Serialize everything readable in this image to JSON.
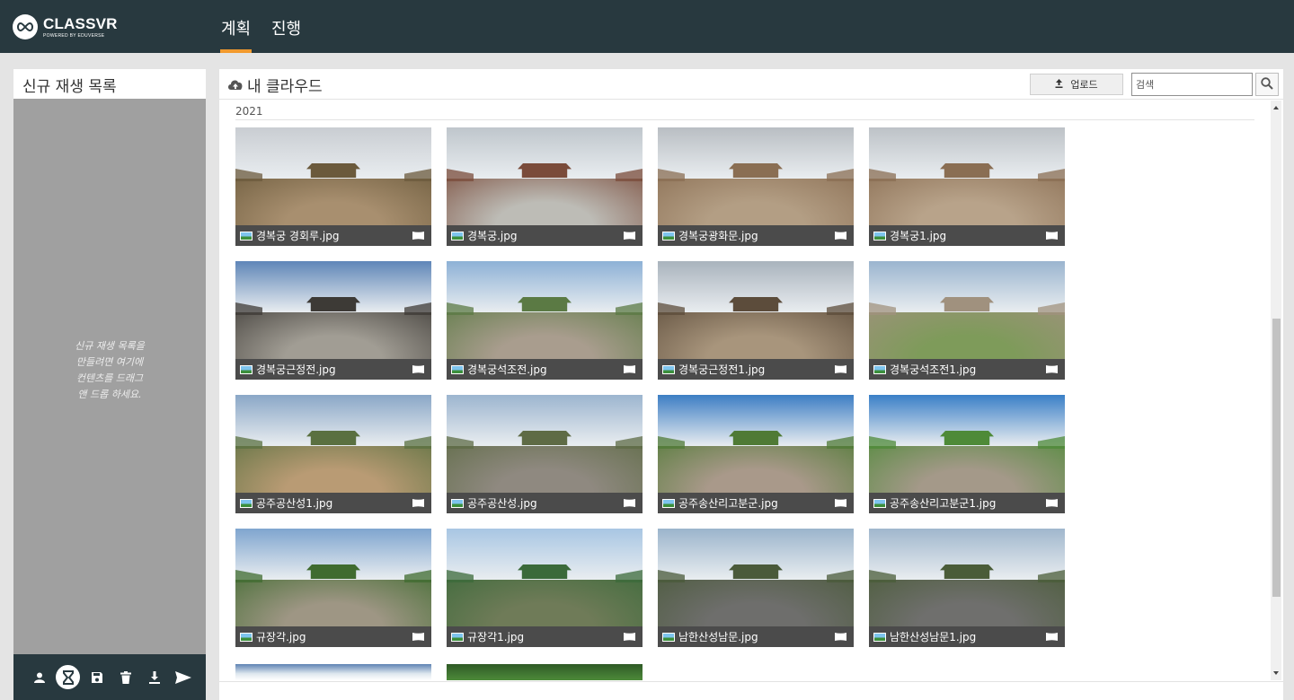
{
  "brand": {
    "name": "CLASSVR",
    "tagline": "POWERED BY EDUVERSE"
  },
  "nav": {
    "tabs": [
      {
        "label": "계획",
        "active": true
      },
      {
        "label": "진행",
        "active": false
      }
    ]
  },
  "playlist": {
    "title": "신규 재생 목록",
    "empty_hint": "신규 재생 목록을 만들려면 여기에 컨텐츠를 드래그 앤 드롭 하세요.",
    "tools": [
      "user-icon",
      "hourglass-icon",
      "save-icon",
      "trash-icon",
      "download-icon",
      "send-icon"
    ]
  },
  "cloud": {
    "title": "내 클라우드",
    "upload_label": "업로드",
    "search_placeholder": "검색",
    "year": "2021",
    "items": [
      {
        "name": "경복궁 경회루.jpg",
        "palette": [
          "#c9cdd2",
          "#a88f6f",
          "#6b5a3c"
        ]
      },
      {
        "name": "경복궁.jpg",
        "palette": [
          "#bfc6cc",
          "#bdbcb6",
          "#7a4b3a"
        ]
      },
      {
        "name": "경복궁광화문.jpg",
        "palette": [
          "#b9bec3",
          "#b39e84",
          "#8a6e53"
        ]
      },
      {
        "name": "경복궁1.jpg",
        "palette": [
          "#bdc2c7",
          "#b8a38a",
          "#8a6e53"
        ]
      },
      {
        "name": "경복궁근정전.jpg",
        "palette": [
          "#5f86b8",
          "#a19d94",
          "#3d3a36"
        ]
      },
      {
        "name": "경복궁석조전.jpg",
        "palette": [
          "#8db1d6",
          "#a99d8e",
          "#5b7a44"
        ]
      },
      {
        "name": "경복궁근정전1.jpg",
        "palette": [
          "#a9b3bd",
          "#a8957c",
          "#5c4c3b"
        ]
      },
      {
        "name": "경복궁석조전1.jpg",
        "palette": [
          "#9ab4cf",
          "#7e9b5a",
          "#a0917e"
        ]
      },
      {
        "name": "공주공산성1.jpg",
        "palette": [
          "#8aa7c7",
          "#b99b74",
          "#5a7040"
        ]
      },
      {
        "name": "공주공산성.jpg",
        "palette": [
          "#9cb5cf",
          "#8f8980",
          "#5e6b45"
        ]
      },
      {
        "name": "공주송산리고분군.jpg",
        "palette": [
          "#3d7ec4",
          "#a9998a",
          "#4f7a35"
        ]
      },
      {
        "name": "공주송산리고분군1.jpg",
        "palette": [
          "#3a7fc7",
          "#a49989",
          "#4e8a38"
        ]
      },
      {
        "name": "규장각.jpg",
        "palette": [
          "#7fa5cf",
          "#9e9684",
          "#3f6b2f"
        ]
      },
      {
        "name": "규장각1.jpg",
        "palette": [
          "#a8c6e3",
          "#6f7b58",
          "#3b6a3a"
        ]
      },
      {
        "name": "남한산성남문.jpg",
        "palette": [
          "#9bb4cc",
          "#6e6e6c",
          "#4a5a3a"
        ]
      },
      {
        "name": "남한산성남문1.jpg",
        "palette": [
          "#a0b7cd",
          "#6f6f6d",
          "#4a5c38"
        ]
      }
    ]
  }
}
